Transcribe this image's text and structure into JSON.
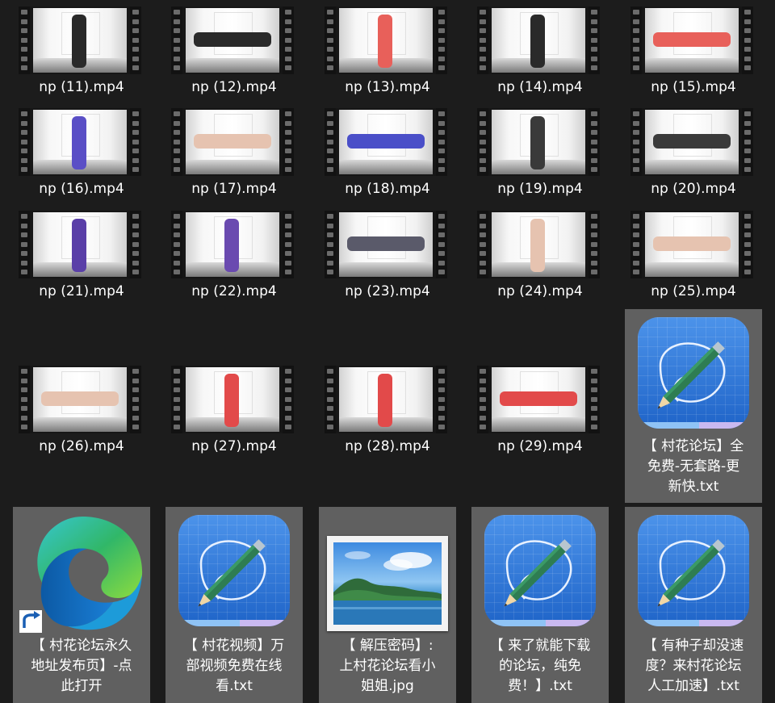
{
  "files": {
    "videos": [
      {
        "name": "np (11).mp4"
      },
      {
        "name": "np (12).mp4"
      },
      {
        "name": "np (13).mp4"
      },
      {
        "name": "np (14).mp4"
      },
      {
        "name": "np (15).mp4"
      },
      {
        "name": "np (16).mp4"
      },
      {
        "name": "np (17).mp4"
      },
      {
        "name": "np (18).mp4"
      },
      {
        "name": "np (19).mp4"
      },
      {
        "name": "np (20).mp4"
      },
      {
        "name": "np (21).mp4"
      },
      {
        "name": "np (22).mp4"
      },
      {
        "name": "np (23).mp4"
      },
      {
        "name": "np (24).mp4"
      },
      {
        "name": "np (25).mp4"
      },
      {
        "name": "np (26).mp4"
      },
      {
        "name": "np (27).mp4"
      },
      {
        "name": "np (28).mp4"
      },
      {
        "name": "np (29).mp4"
      }
    ],
    "txt_1": {
      "name": "【 村花论坛】全\n免费-无套路-更\n新快.txt",
      "icon": "notepad-pencil-icon"
    },
    "shortcut": {
      "name": "【 村花论坛永久\n地址发布页】-点\n此打开",
      "icon": "edge-browser-icon",
      "overlay": "shortcut-arrow-icon"
    },
    "txt_2": {
      "name": "【 村花视频】万\n部视频免费在线\n看.txt",
      "icon": "notepad-pencil-icon"
    },
    "jpg": {
      "name": "【 解压密码】:\n上村花论坛看小\n姐姐.jpg",
      "icon": "landscape-photo-icon"
    },
    "txt_3": {
      "name": "【 来了就能下载\n的论坛，纯免\n费！】.txt",
      "icon": "notepad-pencil-icon"
    },
    "txt_4": {
      "name": "【 有种子却没速\n度？来村花论坛\n人工加速】.txt",
      "icon": "notepad-pencil-icon"
    }
  },
  "colors": {
    "background": "#1c1c1c",
    "selected_tile": "#606060",
    "text": "#ffffff",
    "notepad_blue": "#2d78dd",
    "pencil_green": "#2e7d52"
  }
}
